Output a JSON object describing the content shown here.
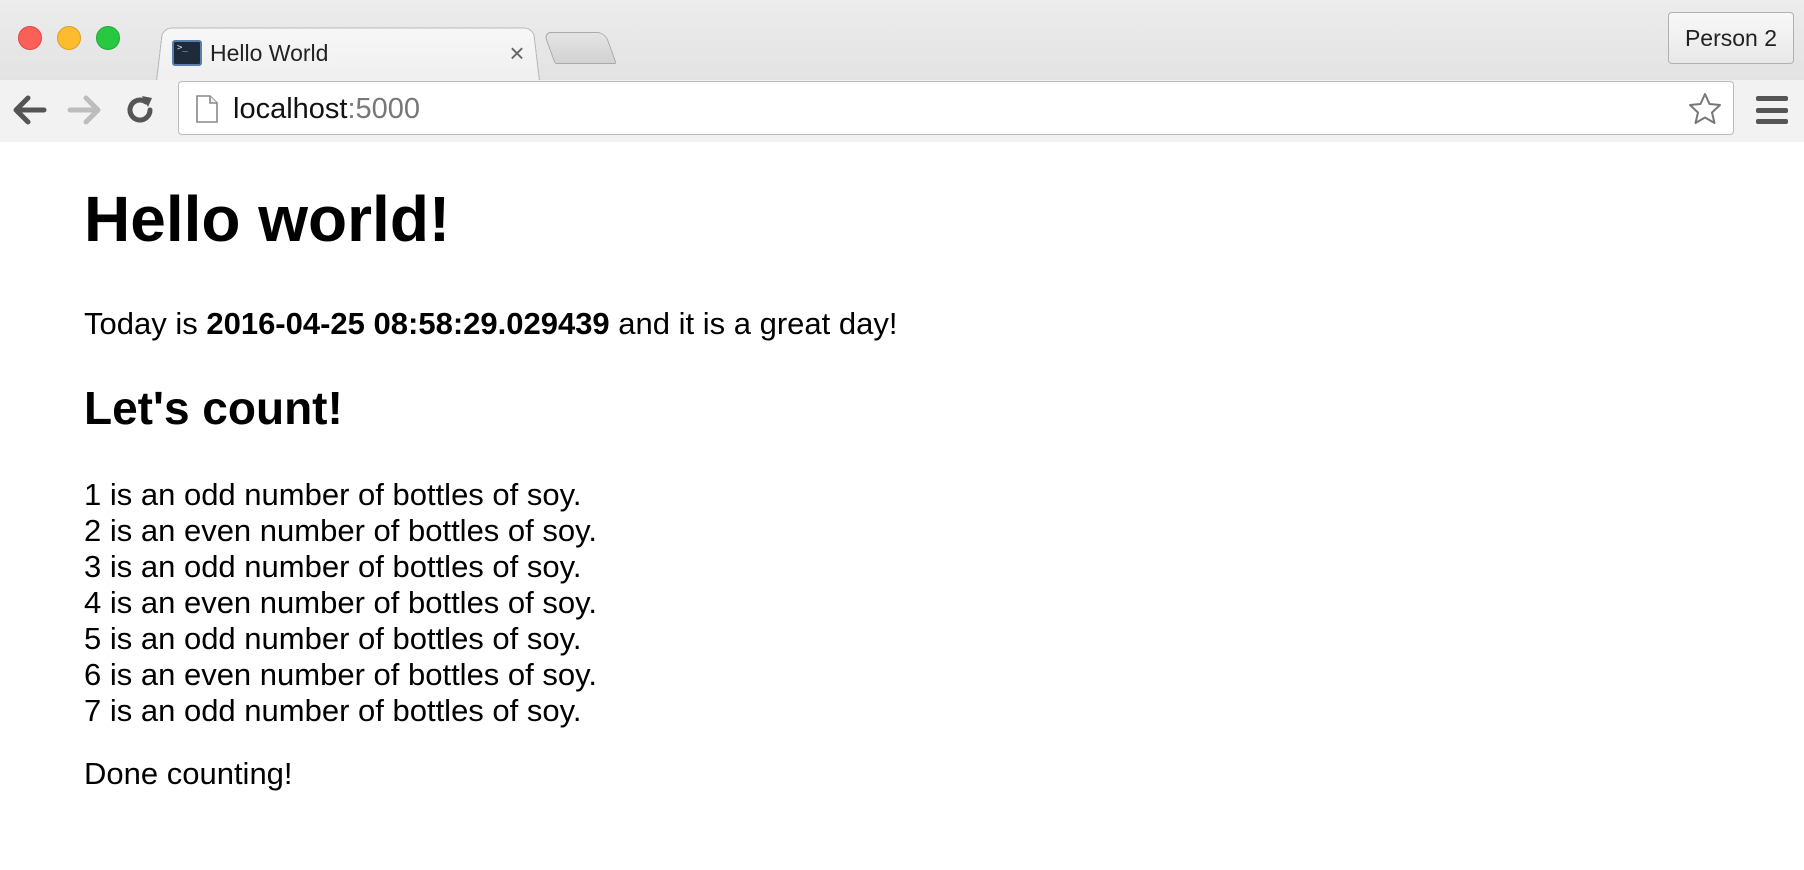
{
  "window": {
    "tab_title": "Hello World",
    "tab_close": "×",
    "profile_label": "Person 2"
  },
  "toolbar": {
    "url_host": "localhost",
    "url_port": ":5000"
  },
  "page": {
    "heading": "Hello world!",
    "today_prefix": "Today is ",
    "today_value": "2016-04-25 08:58:29.029439",
    "today_suffix": " and it is a great day!",
    "subheading": "Let's count!",
    "count_lines": [
      "1 is an odd number of bottles of soy.",
      "2 is an even number of bottles of soy.",
      "3 is an odd number of bottles of soy.",
      "4 is an even number of bottles of soy.",
      "5 is an odd number of bottles of soy.",
      "6 is an even number of bottles of soy.",
      "7 is an odd number of bottles of soy."
    ],
    "footer": "Done counting!"
  }
}
